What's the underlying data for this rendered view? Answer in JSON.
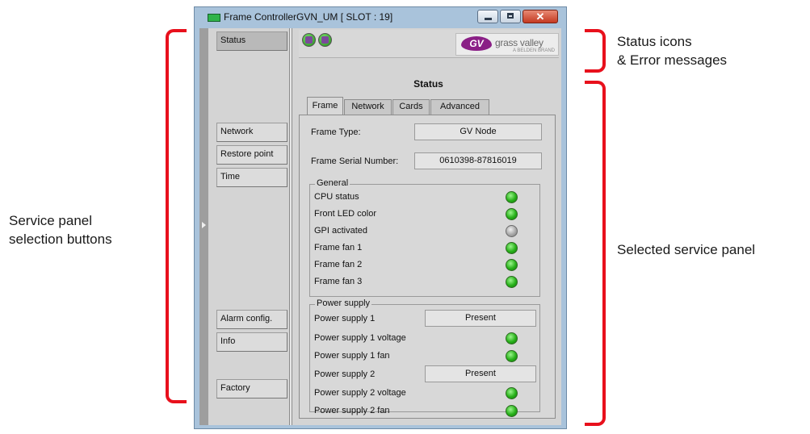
{
  "window": {
    "title": "Frame ControllerGVN_UM [ SLOT : 19]",
    "close_glyph": "✕"
  },
  "annotations": {
    "status_line1": "Status icons",
    "status_line2": "& Error messages",
    "left_line1": "Service panel",
    "left_line2": "selection buttons",
    "right": "Selected service panel",
    "bracket_color": "#e8101c"
  },
  "sidebar": {
    "items": [
      {
        "label": "Status",
        "active": true
      },
      {
        "label": "Network"
      },
      {
        "label": "Restore point"
      },
      {
        "label": "Time"
      },
      {
        "label": "Alarm config."
      },
      {
        "label": "Info"
      },
      {
        "label": "Factory"
      }
    ]
  },
  "logo": {
    "mark": "GV",
    "text": "grass valley",
    "sub": "A BELDEN BRAND"
  },
  "panel": {
    "title": "Status",
    "tabs": [
      "Frame",
      "Network",
      "Cards",
      "Advanced"
    ],
    "frame_type_label": "Frame Type:",
    "frame_type_value": "GV Node",
    "serial_label": "Frame Serial Number:",
    "serial_value": "0610398-87816019"
  },
  "general": {
    "title": "General",
    "rows": [
      {
        "label": "CPU status",
        "led": "green"
      },
      {
        "label": "Front LED color",
        "led": "green"
      },
      {
        "label": "GPI activated",
        "led": "gray"
      },
      {
        "label": "Frame fan 1",
        "led": "green"
      },
      {
        "label": "Frame fan 2",
        "led": "green"
      },
      {
        "label": "Frame fan 3",
        "led": "green"
      }
    ]
  },
  "power": {
    "title": "Power supply",
    "rows": [
      {
        "label": "Power supply 1",
        "value": "Present"
      },
      {
        "label": "Power supply 1 voltage",
        "led": "green"
      },
      {
        "label": "Power supply 1 fan",
        "led": "green"
      },
      {
        "label": "Power supply 2",
        "value": "Present"
      },
      {
        "label": "Power supply 2 voltage",
        "led": "green"
      },
      {
        "label": "Power supply 2 fan",
        "led": "green"
      }
    ]
  }
}
